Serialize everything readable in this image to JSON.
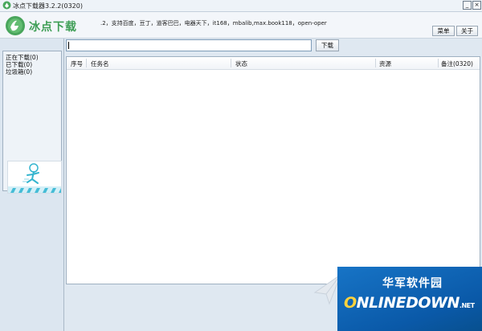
{
  "window": {
    "title": "冰点下载器3.2.2(0320)",
    "minimize_label": "_",
    "close_label": "×"
  },
  "header": {
    "logo_text": "冰点下载",
    "marquee": ".2，支持百度，豆丁，道客巴巴，电器天下，it168，mbalib,max.book118，open-oper",
    "menu_label": "菜单",
    "about_label": "关于"
  },
  "sidebar": {
    "items": [
      {
        "label": "正在下载(0)"
      },
      {
        "label": "已下载(0)"
      },
      {
        "label": "垃圾箱(0)"
      }
    ]
  },
  "toolbar": {
    "url_value": "",
    "url_placeholder": "",
    "download_label": "下载"
  },
  "table": {
    "columns": [
      {
        "label": "序号"
      },
      {
        "label": "任务名"
      },
      {
        "label": "状态"
      },
      {
        "label": "资源"
      },
      {
        "label": "备注(0320)"
      }
    ],
    "rows": []
  },
  "watermark": {
    "cn": "华军软件园",
    "en_prefix": "",
    "en_o": "O",
    "en_main": "NLINEDOWN",
    "en_suffix": ".NET"
  },
  "colors": {
    "brand_green": "#3e9e55",
    "watermark_blue": "#0a59a8",
    "watermark_accent": "#ffd23c"
  }
}
